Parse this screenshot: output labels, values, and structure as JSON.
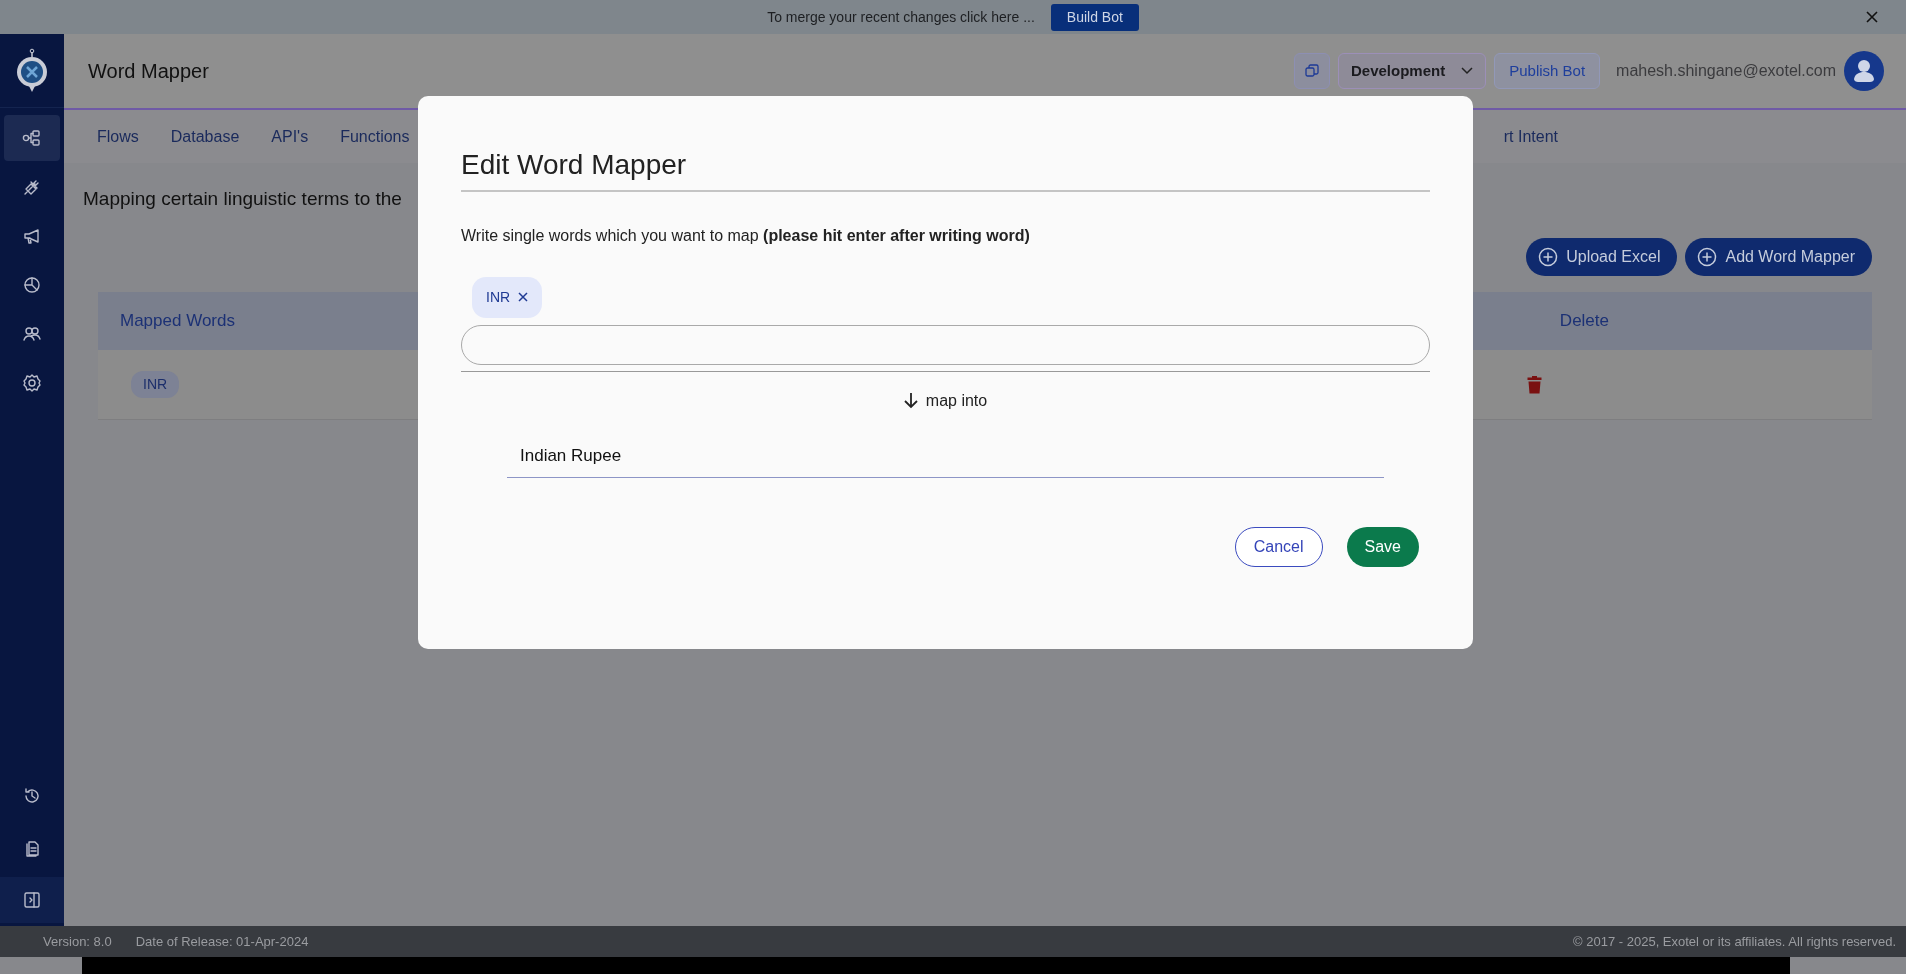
{
  "banner": {
    "text": "To merge your recent changes click here ...",
    "button": "Build Bot"
  },
  "header": {
    "title": "Word Mapper",
    "environment": "Development",
    "publish_button": "Publish Bot",
    "user_email": "mahesh.shingane@exotel.com"
  },
  "sidebar": {
    "items": [
      {
        "selected": true
      },
      {
        "selected": false
      },
      {
        "selected": false
      },
      {
        "selected": false
      },
      {
        "selected": false
      },
      {
        "selected": false
      }
    ],
    "bottom_items": [
      {
        "selected": false
      },
      {
        "selected": false
      },
      {
        "selected": false
      }
    ]
  },
  "tabs": [
    {
      "label": "Flows"
    },
    {
      "label": "Database"
    },
    {
      "label": "API's"
    },
    {
      "label": "Functions"
    },
    {
      "label": "rt Intent"
    }
  ],
  "page": {
    "description": "Mapping certain linguistic terms to the",
    "buttons": [
      "Upload Excel",
      "Add Word Mapper"
    ]
  },
  "table": {
    "columns": [
      "Mapped Words",
      "Delete"
    ],
    "rows": [
      {
        "mapped_words": [
          "INR"
        ]
      }
    ]
  },
  "modal": {
    "title": "Edit Word Mapper",
    "instruction": "Write single words which you want to map **(please hit enter after writing word)**",
    "chips": [
      "INR"
    ],
    "map_label": "map into",
    "target_value": "Indian Rupee",
    "cancel_button": "Cancel",
    "save_button": "Save"
  },
  "footer": {
    "version": "Version: 8.0",
    "release": "Date of Release: 01-Apr-2024",
    "copyright": "© 2017 - 2025, Exotel or its affiliates. All rights reserved."
  }
}
